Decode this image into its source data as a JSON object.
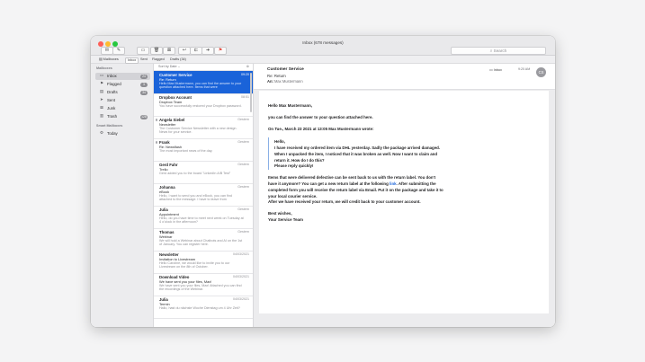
{
  "window": {
    "title": "Inbox (678 messages)"
  },
  "toolbar": {
    "search_placeholder": "Search",
    "buttons": [
      {
        "name": "get-mail-button",
        "glyph": "✉"
      },
      {
        "name": "compose-button",
        "glyph": "✎"
      },
      {
        "name": "archive-button",
        "glyph": "▭"
      },
      {
        "name": "trash-button",
        "glyph": "🗑"
      },
      {
        "name": "junk-button",
        "glyph": "⊠"
      },
      {
        "name": "reply-button",
        "glyph": "↩"
      },
      {
        "name": "reply-all-button",
        "glyph": "⇇"
      },
      {
        "name": "forward-button",
        "glyph": "➜"
      },
      {
        "name": "flag-button",
        "glyph": "⚑"
      }
    ]
  },
  "favorites": [
    "Mailboxes",
    "Inbox",
    "Sent",
    "Flagged",
    "Drafts (34)"
  ],
  "sidebar": {
    "section_mailboxes": "Mailboxes",
    "items": [
      {
        "label": "Inbox",
        "icon": "inbox-icon",
        "glyph": "▭",
        "badge": "24",
        "active": true
      },
      {
        "label": "Flagged",
        "icon": "flag-icon",
        "glyph": "⚑",
        "badge": "3",
        "active": false
      },
      {
        "label": "Drafts",
        "icon": "draft-icon",
        "glyph": "▤",
        "badge": "34",
        "active": false
      },
      {
        "label": "Sent",
        "icon": "sent-icon",
        "glyph": "➤",
        "badge": "",
        "active": false
      },
      {
        "label": "Junk",
        "icon": "junk-icon",
        "glyph": "⊠",
        "badge": "",
        "active": false
      },
      {
        "label": "Trash",
        "icon": "trash-icon",
        "glyph": "▥",
        "badge": "128",
        "active": false
      }
    ],
    "section_smart": "Smart Mailboxes",
    "smart_items": [
      {
        "label": "Today",
        "icon": "gear-icon",
        "glyph": "⚙"
      }
    ]
  },
  "list": {
    "sort_label": "Sort by Date ⌄",
    "messages": [
      {
        "from": "Customer Service",
        "date": "09:20",
        "subject": "Re: Return",
        "preview": "Hello Max Mustermann, you can find the answer to your question attached here. Items that were",
        "selected": true
      },
      {
        "from": "Dropbox Account",
        "date": "08:51",
        "subject": "Dropbox Team",
        "preview": "You have successfully restored your Dropbox password.",
        "selected": false
      },
      {
        "from": "Angela Siebel",
        "date": "Gestern",
        "subject": "Newsletter",
        "preview": "The Customer Service Newsletter with a new design. News for your service.",
        "selected": false
      },
      {
        "from": "Frank",
        "date": "Gestern",
        "subject": "Re: Newsflash",
        "preview": "The most important news of the day.",
        "selected": false
      },
      {
        "from": "Gerd Fahr",
        "date": "Gestern",
        "subject": "Trello",
        "preview": "Gerd added you to the board \"LinkedIn A/B Test\"",
        "selected": false
      },
      {
        "from": "Johanna",
        "date": "Gestern",
        "subject": "eBook",
        "preview": "Hello, I want to send you and eBook, you can find attached to the message. I have to leave from",
        "selected": false
      },
      {
        "from": "Julia",
        "date": "Gestern",
        "subject": "Appointment",
        "preview": "Hello, do you have time to meet next week on Tuesday at 4 o'clock in the afternoon?",
        "selected": false
      },
      {
        "from": "Thomas",
        "date": "Gestern",
        "subject": "Webinar",
        "preview": "We will hold a Webinar about Chatbots and AI on the 1st of January. You can register here.",
        "selected": false
      },
      {
        "from": "Newsletter",
        "date": "04/03/2021",
        "subject": "Invitation to Livestream",
        "preview": "Hello Caroline, we would like to invite you to our Livestream on the 8th of October.",
        "selected": false
      },
      {
        "from": "Download Video",
        "date": "04/03/2021",
        "subject": "We have sent you your files, Max!",
        "preview": "We have sent you your files, Max! Attached you can find the recordings of the Webinar.",
        "selected": false
      },
      {
        "from": "Julia",
        "date": "04/03/2021",
        "subject": "Termin",
        "preview": "Hallo, hast du nächste Woche Dienstag um 4 Uhr Zeit?",
        "selected": false
      }
    ]
  },
  "reader": {
    "from": "Customer Service",
    "subject": "Re: Return",
    "to_label": "An:",
    "to_value": "Max Mustermann",
    "mailbox": "Inbox",
    "time": "9:20 AM",
    "avatar_initials": "CS",
    "body": {
      "greeting": "Hello Max Mustermann,",
      "line1": "you can find the answer to your question attached here.",
      "quote_header": "On Tue., March 23 2021 at 13:05 Max Mustermann wrote:",
      "quote_hello": "Hello,",
      "quote_text": "I have received my ordered item via DHL yesterday. Sadly the package arrived damaged. When I unpacked the item, I noticed that it was broken as well. Now I want to claim and return it. How do I do this?",
      "quote_reply": "Please reply quickly!",
      "para1_before": "Items that were delivered defective can be sent back to us with the return label. You don't have it anymore? You can get a new return label at the following",
      "para1_link": "link",
      "para1_after": ". After submitting the completed form you will receive the return label via Email. Put it on the package and take it to your local courier service.",
      "para2": "After we have received your return, we will credit back to your customer account.",
      "closing1": "Best wishes,",
      "closing2": "Your Service Team"
    }
  }
}
